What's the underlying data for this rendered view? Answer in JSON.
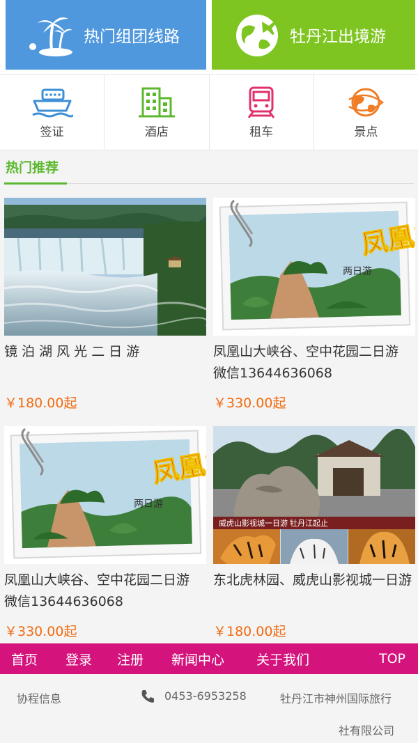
{
  "banners": {
    "left_label": "热门组团线路",
    "right_label": "牡丹江出境游",
    "left_color": "#4f98de",
    "right_color": "#7ec521",
    "left_icon": "palm-island-icon",
    "right_icon": "globe-airplane-icon"
  },
  "categories": [
    {
      "label": "签证",
      "icon": "ship-icon",
      "color": "#3d8fd6"
    },
    {
      "label": "酒店",
      "icon": "building-icon",
      "color": "#5cb82e"
    },
    {
      "label": "租车",
      "icon": "train-icon",
      "color": "#e0306e"
    },
    {
      "label": "景点",
      "icon": "globe-icon",
      "color": "#f07c24"
    }
  ],
  "section": {
    "title": "热门推荐"
  },
  "products": [
    {
      "title": "镜 泊 湖 风 光 二 日 游",
      "price": "￥180.00起"
    },
    {
      "title": "凤凰山大峡谷、空中花园二日游 微信13644636068",
      "price": "￥330.00起"
    },
    {
      "title": "凤凰山大峡谷、空中花园二日游 微信13644636068",
      "price": "￥330.00起"
    },
    {
      "title": "东北虎林园、威虎山影视城一日游",
      "price": "￥180.00起"
    }
  ],
  "image_captions": {
    "tiger_banner": "威虎山影视城一日游  牡丹江起止",
    "fenghuang_logo": "凤凰山",
    "two_day": "两日游"
  },
  "nav": {
    "home": "首页",
    "login": "登录",
    "register": "注册",
    "news": "新闻中心",
    "about": "关于我们",
    "top": "TOP",
    "color": "#d4137d"
  },
  "footer": {
    "info_label": "协程信息",
    "phone": "0453-6953258",
    "company_line1": "牡丹江市神州国际旅行",
    "company_line2": "社有限公司"
  },
  "colors": {
    "accent_green": "#5cb82e",
    "price": "#f26a10"
  }
}
